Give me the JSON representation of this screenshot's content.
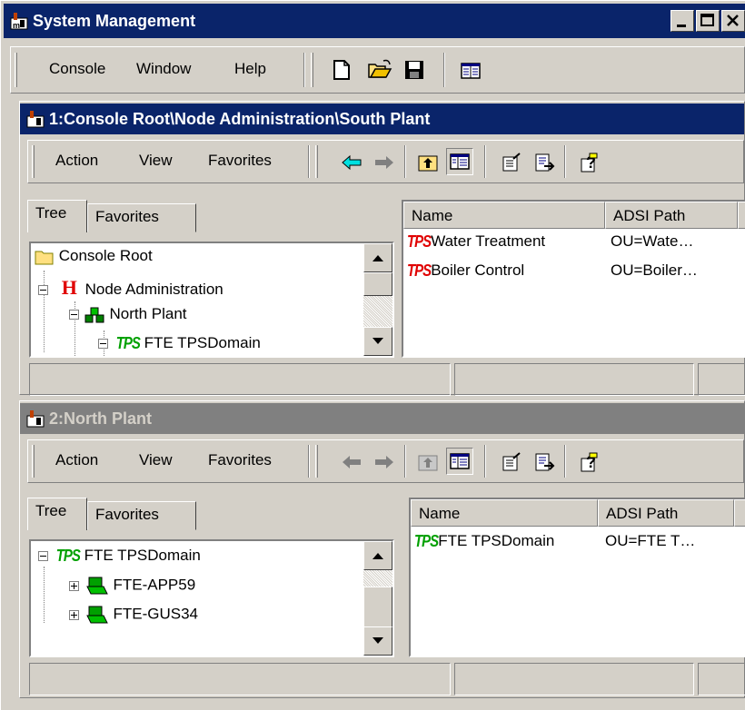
{
  "app": {
    "title": "System Management"
  },
  "window_buttons": {
    "minimize": "_",
    "maximize": "□",
    "close": "×"
  },
  "main_menu": {
    "console": "Console",
    "window": "Window",
    "help": "Help"
  },
  "child1": {
    "title": "1:Console Root\\Node Administration\\South Plant",
    "menu": {
      "action": "Action",
      "view": "View",
      "favorites": "Favorites"
    },
    "tabs": {
      "tree": "Tree",
      "favorites": "Favorites"
    },
    "tree": [
      {
        "label": "Console Root"
      },
      {
        "label": "Node Administration",
        "icon_text": "H"
      },
      {
        "label": "North Plant"
      },
      {
        "label": "FTE TPSDomain",
        "icon_text": "TPS"
      }
    ],
    "columns": {
      "name": "Name",
      "adsi": "ADSI Path"
    },
    "rows": [
      {
        "icon_text": "TPS",
        "name": "Water Treatment",
        "adsi": "OU=Wate…"
      },
      {
        "icon_text": "TPS",
        "name": "Boiler Control",
        "adsi": "OU=Boiler…"
      }
    ]
  },
  "child2": {
    "title": "2:North Plant",
    "menu": {
      "action": "Action",
      "view": "View",
      "favorites": "Favorites"
    },
    "tabs": {
      "tree": "Tree",
      "favorites": "Favorites"
    },
    "tree": [
      {
        "label": "FTE TPSDomain",
        "icon_text": "TPS"
      },
      {
        "label": "FTE-APP59"
      },
      {
        "label": "FTE-GUS34"
      }
    ],
    "columns": {
      "name": "Name",
      "adsi": "ADSI Path"
    },
    "rows": [
      {
        "icon_text": "TPS",
        "name": "FTE TPSDomain",
        "adsi": "OU=FTE T…"
      }
    ]
  },
  "colors": {
    "active_title": "#0a246a",
    "inactive_title": "#808080",
    "tps_red": "#e00000",
    "tps_green": "#00a000"
  }
}
